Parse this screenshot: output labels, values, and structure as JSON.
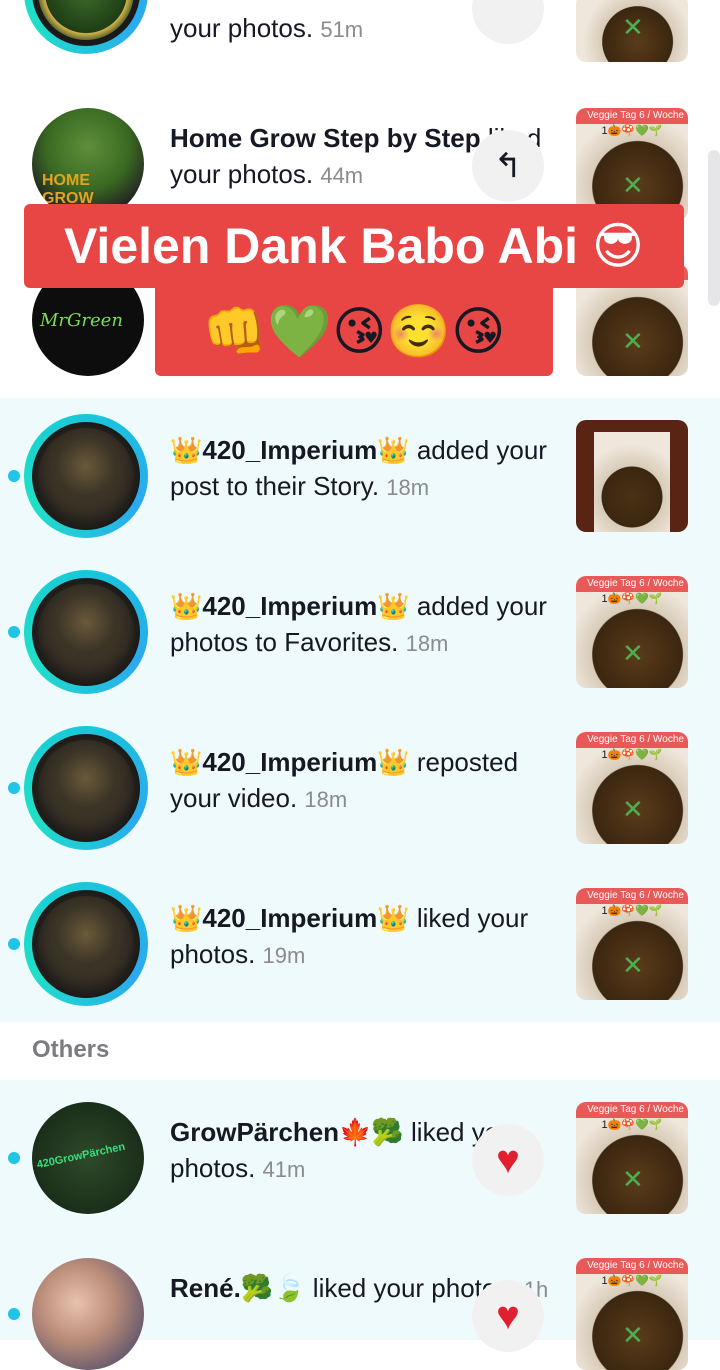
{
  "notifications": [
    {
      "text_tail": "your photos.",
      "time": "51m",
      "unread": false,
      "avatar": "community-logo",
      "ring": true
    },
    {
      "name": "Home Grow Step by Step",
      "action": " liked your photos.",
      "time": "44m",
      "unread": false,
      "avatar": "home-grow-logo",
      "button": "reply-arrow-icon"
    },
    {
      "name": "",
      "action": "",
      "time": "",
      "unread": false,
      "avatar": "mr-green-genetics-logo"
    },
    {
      "name": "👑420_Imperium👑",
      "action": " added your post to their Story.",
      "time": "18m",
      "unread": true,
      "ring": true
    },
    {
      "name": "👑420_Imperium👑",
      "action": " added your photos to Favorites.",
      "time": "18m",
      "unread": true,
      "ring": true
    },
    {
      "name": "👑420_Imperium👑",
      "action": " reposted your video.",
      "time": "18m",
      "unread": true,
      "ring": true
    },
    {
      "name": "👑420_Imperium👑",
      "action": " liked your photos.",
      "time": "19m",
      "unread": true,
      "ring": true
    },
    {
      "name": "GrowPärchen🍁🥦",
      "action": " liked your photos.",
      "time": "41m",
      "unread": true,
      "button": "heart-icon"
    },
    {
      "name": "René.🥦🍃",
      "action": " liked your photos.",
      "time": "1h",
      "unread": true,
      "button": "heart-icon"
    }
  ],
  "section": {
    "others": "Others"
  },
  "overlay": {
    "line1": "Vielen Dank Babo Abi 😎",
    "line2": "👊💚😘☺️😘"
  },
  "thumb": {
    "tag": "Veggie Tag 6 / Woche",
    "emoji": "1🎃🍄💚🌱"
  },
  "colors": {
    "unread_bg": "#eefafc",
    "unread_dot": "#20c4e6",
    "banner": "#e84545",
    "heart": "#e0202f"
  }
}
